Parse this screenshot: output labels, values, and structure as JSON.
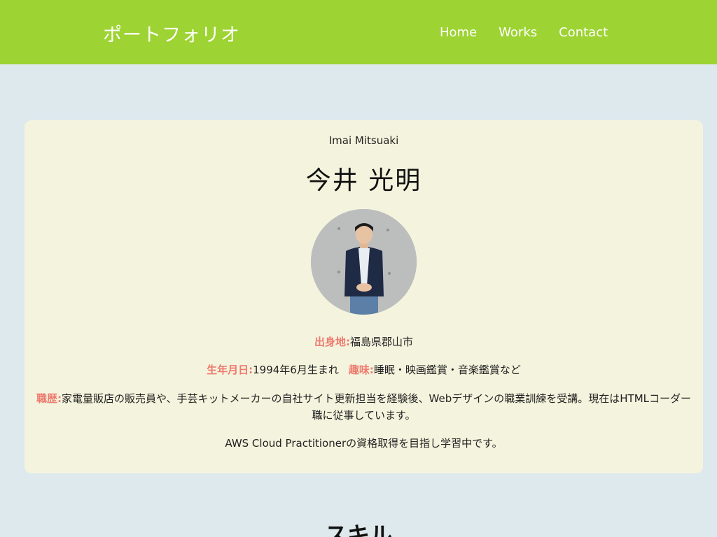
{
  "header": {
    "site_title": "ポートフォリオ",
    "nav": [
      "Home",
      "Works",
      "Contact"
    ]
  },
  "profile": {
    "romaji": "Imai Mitsuaki",
    "name": "今井 光明",
    "birthplace_label": "出身地:",
    "birthplace": "福島県郡山市",
    "birthdate_label": "生年月日:",
    "birthdate": "1994年6月生まれ",
    "hobby_label": "趣味:",
    "hobby": "睡眠・映画鑑賞・音楽鑑賞など",
    "career_label": "職歴:",
    "career": "家電量販店の販売員や、手芸キットメーカーの自社サイト更新担当を経験後、Webデザインの職業訓練を受講。現在はHTMLコーダー職に従事しています。",
    "goal": "AWS Cloud Practitionerの資格取得を目指し学習中です。"
  },
  "skills": {
    "heading": "スキル"
  }
}
